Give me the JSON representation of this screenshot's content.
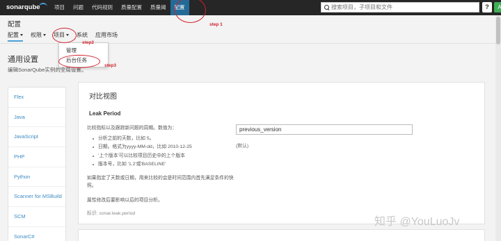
{
  "navbar": {
    "logo": "sonarqube",
    "items": [
      "项目",
      "问题",
      "代码规则",
      "质量配置",
      "质量阈",
      "配置"
    ],
    "search_placeholder": "搜索项目，子项目和文件",
    "help_label": "?",
    "avatar_label": "A"
  },
  "page": {
    "title": "配置",
    "subnav": [
      "配置",
      "权限",
      "项目",
      "系统",
      "应用市场"
    ]
  },
  "dropdown": {
    "items": [
      "管理",
      "后台任务"
    ]
  },
  "settings": {
    "heading": "通用设置",
    "description": "编辑SonarQube实例的全局设置。"
  },
  "categories": [
    "Flex",
    "Java",
    "JavaScript",
    "PHP",
    "Python",
    "Scanner for MSBuild",
    "SCM",
    "SonarC#"
  ],
  "panel": {
    "title": "对比视图",
    "setting_name": "Leak Period",
    "setting_description": "比较指标以及跟踪新问题的周期。数值为：",
    "bullets": [
      "分析之前的天数，比如 5。",
      "日期。格式为yyyy-MM-dd，比如 2010-12-25",
      "'上个版本'可以比较项目历史中的上个版本",
      "版本号，比如 '1.2'或'BASELINE'"
    ],
    "note_1": "如果指定了天数或日期，用来比较的会是时间范围内首先满足条件的快照。",
    "note_2": "属性修改后要影响以后的项目分析。",
    "key": "标识: sonar.leak.period",
    "value": "previous_version",
    "default_label": "(默认)"
  },
  "annotations": {
    "step1": "step 1",
    "step2": "step2",
    "step3": "step3",
    "color": "#d0212b"
  },
  "watermark": "知乎 @YouLuoJv",
  "colors": {
    "navbar_bg": "#262626",
    "nav_active_bg": "#236a97",
    "link": "#3c8cc4",
    "avatar_bg": "#3fae55"
  }
}
